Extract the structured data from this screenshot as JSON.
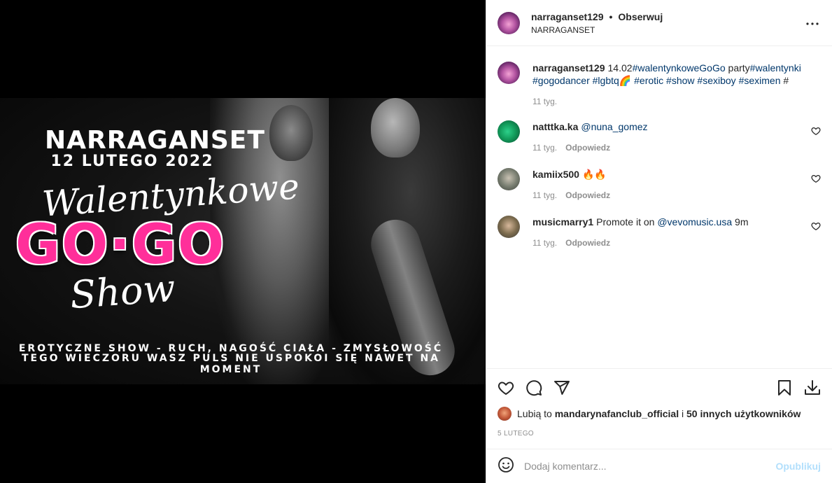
{
  "post": {
    "username": "narraganset129",
    "follow_label": "Obserwuj",
    "dot": "•",
    "subtitle": "NARRAGANSET",
    "more_icon": "more-horizontal-icon"
  },
  "poster": {
    "title": "NARRAGANSET",
    "date": "12 LUTEGO 2022",
    "script_top": "Walentynkowe",
    "headline": "GO·GO",
    "script_bottom": "Show",
    "line1": "EROTYCZNE SHOW - RUCH, NAGOŚĆ CIAŁA - ZMYSŁOWOŚĆ",
    "line2": "TEGO WIECZORU WASZ PULS NIE USPOKOI SIĘ NAWET NA MOMENT",
    "accent": "#ff2f9a"
  },
  "caption": {
    "username": "narraganset129",
    "text_a": "14.02",
    "tag1": "#walentynkoweGoGo",
    "text_b": " party",
    "tag2": "#walentynki",
    "tag3": "#gogodancer",
    "tag4": "#lgbtq",
    "rainbow": "🌈",
    "tag5": "#erotic",
    "tag6": "#show",
    "tag7": "#sexiboy",
    "tag8": "#seximen",
    "tag9": "#",
    "time": "11 tyg."
  },
  "comments": [
    {
      "username": "natttka.ka",
      "mention": "@nuna_gomez",
      "text": "",
      "time": "11 tyg.",
      "reply": "Odpowiedz"
    },
    {
      "username": "kamiix500",
      "mention": "",
      "text": "🔥🔥",
      "time": "11 tyg.",
      "reply": "Odpowiedz"
    },
    {
      "username": "musicmarry1",
      "text_before": "Promote it on ",
      "mention": "@vevomusic.usa",
      "text_after": " 9m",
      "time": "11 tyg.",
      "reply": "Odpowiedz"
    }
  ],
  "likes": {
    "prefix": "Lubią to",
    "user": "mandarynafanclub_official",
    "connector": "i",
    "others": "50 innych użytkowników"
  },
  "date": "5 lutego",
  "add_comment": {
    "placeholder": "Dodaj komentarz...",
    "publish": "Opublikuj"
  },
  "colors": {
    "link": "#00376b",
    "muted": "#8e8e8e",
    "publish_disabled": "#b2dffc"
  }
}
